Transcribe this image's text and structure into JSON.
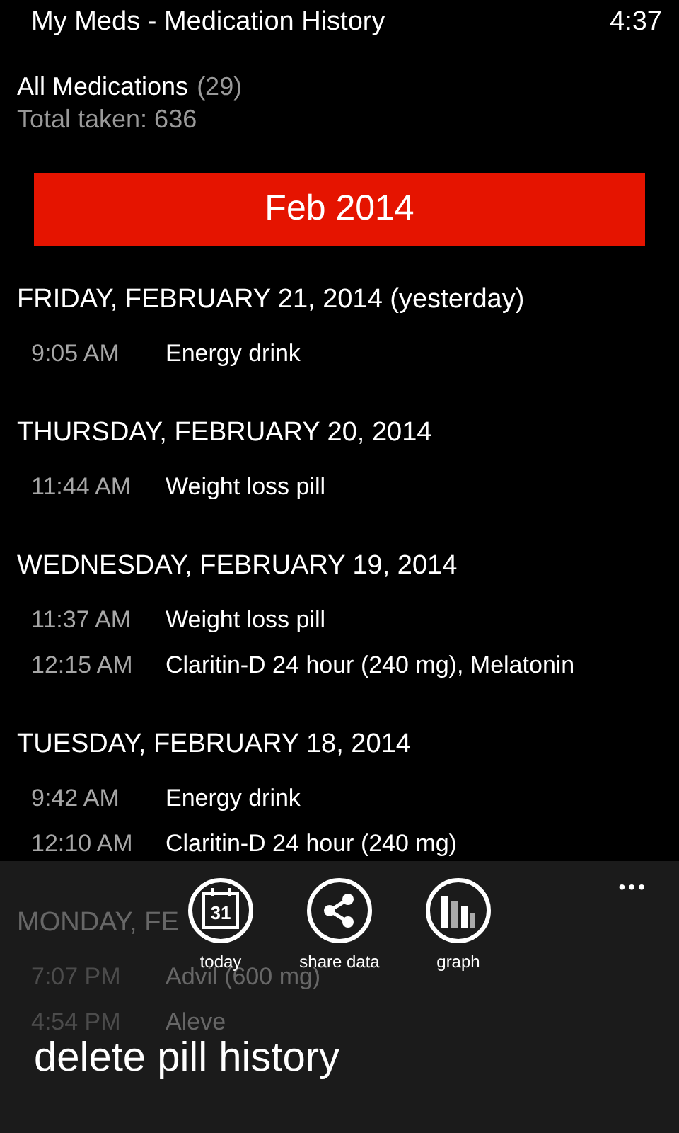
{
  "status_bar": {
    "app_title": "My Meds - Medication History",
    "time": "4:37"
  },
  "summary": {
    "filter": "All Medications",
    "count": "(29)",
    "total": "Total taken: 636"
  },
  "month_banner": "Feb 2014",
  "days": [
    {
      "header": "FRIDAY, FEBRUARY 21, 2014 (yesterday)",
      "entries": [
        {
          "time": "9:05 AM",
          "name": "Energy drink"
        }
      ]
    },
    {
      "header": "THURSDAY, FEBRUARY 20, 2014",
      "entries": [
        {
          "time": "11:44 AM",
          "name": "Weight loss pill"
        }
      ]
    },
    {
      "header": "WEDNESDAY, FEBRUARY 19, 2014",
      "entries": [
        {
          "time": "11:37 AM",
          "name": "Weight loss pill"
        },
        {
          "time": "12:15 AM",
          "name": "Claritin-D 24 hour (240 mg), Melatonin"
        }
      ]
    },
    {
      "header": "TUESDAY, FEBRUARY 18, 2014",
      "entries": [
        {
          "time": "9:42 AM",
          "name": "Energy drink"
        },
        {
          "time": "12:10 AM",
          "name": "Claritin-D 24 hour (240 mg)"
        }
      ]
    },
    {
      "header": "MONDAY, FE",
      "entries": [
        {
          "time": "7:07 PM",
          "name": "Advil (600 mg)"
        },
        {
          "time": "4:54 PM",
          "name": "Aleve"
        }
      ]
    }
  ],
  "app_bar": {
    "more": "•••",
    "buttons": [
      {
        "kind": "calendar",
        "icon_text": "31",
        "label": "today"
      },
      {
        "kind": "share",
        "label": "share data"
      },
      {
        "kind": "graph",
        "label": "graph"
      }
    ],
    "menu_items": [
      "delete pill history"
    ]
  }
}
